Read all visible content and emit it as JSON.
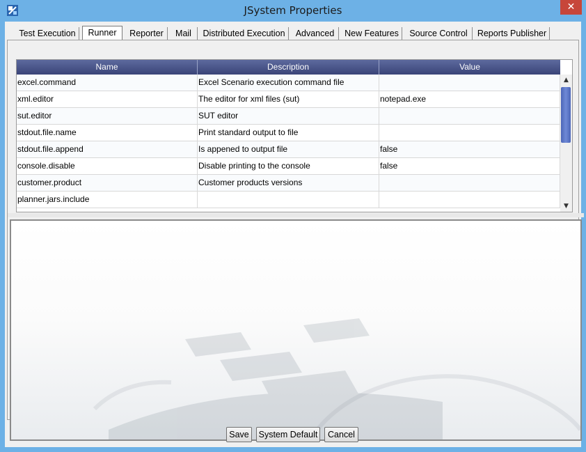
{
  "window": {
    "title": "JSystem Properties",
    "close_label": "✕"
  },
  "tabs": [
    {
      "label": "Test Execution",
      "active": false
    },
    {
      "label": "Runner",
      "active": true
    },
    {
      "label": "Reporter",
      "active": false
    },
    {
      "label": "Mail",
      "active": false
    },
    {
      "label": "Distributed Execution",
      "active": false
    },
    {
      "label": "Advanced",
      "active": false
    },
    {
      "label": "New Features",
      "active": false
    },
    {
      "label": "Source Control",
      "active": false
    },
    {
      "label": "Reports Publisher",
      "active": false
    }
  ],
  "table": {
    "headers": [
      "Name",
      "Description",
      "Value"
    ],
    "rows": [
      {
        "name": "excel.command",
        "description": "Excel Scenario execution command file",
        "value": ""
      },
      {
        "name": "xml.editor",
        "description": "The editor for xml files (sut)",
        "value": "notepad.exe"
      },
      {
        "name": "sut.editor",
        "description": "SUT editor",
        "value": ""
      },
      {
        "name": "stdout.file.name",
        "description": "Print standard output to file",
        "value": ""
      },
      {
        "name": "stdout.file.append",
        "description": "Is appened to output file",
        "value": "false"
      },
      {
        "name": "console.disable",
        "description": "Disable printing to the console",
        "value": "false"
      },
      {
        "name": "customer.product",
        "description": "Customer products versions",
        "value": ""
      },
      {
        "name": "planner.jars.include",
        "description": "",
        "value": ""
      }
    ]
  },
  "scrollbar": {
    "up_glyph": "▲",
    "down_glyph": "▼"
  },
  "buttons": {
    "save": "Save",
    "system_default": "System Default",
    "cancel": "Cancel"
  },
  "colors": {
    "frame": "#6db1e6",
    "header": "#3a4478",
    "close": "#c7463a"
  }
}
